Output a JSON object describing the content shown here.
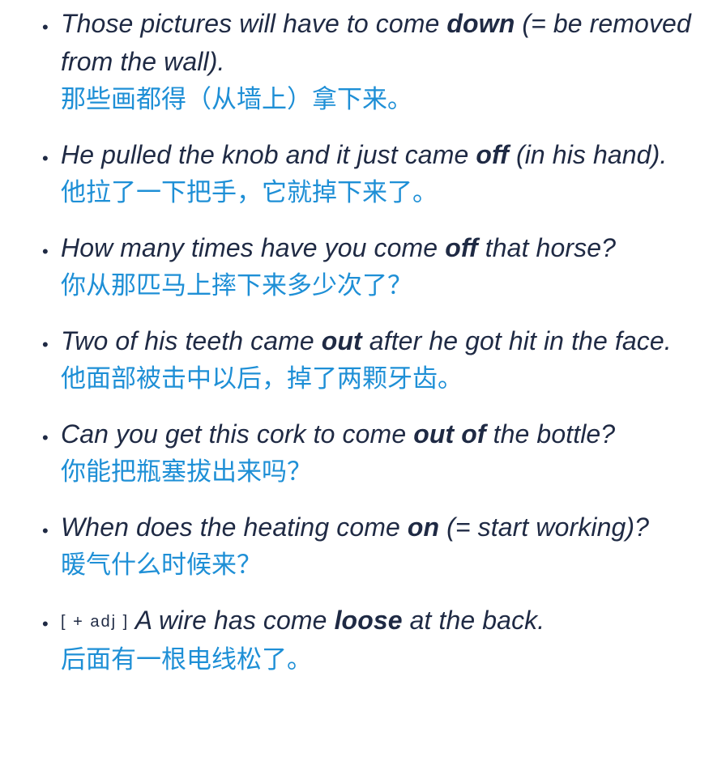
{
  "examples": [
    {
      "pre": "Those pictures will have to come ",
      "keyword": "down",
      "post": " (= be removed from the wall).",
      "translation": "那些画都得（从墙上）拿下来。"
    },
    {
      "pre": "He pulled the knob and it just came ",
      "keyword": "off",
      "post": " (in his hand).",
      "translation": "他拉了一下把手，它就掉下来了。"
    },
    {
      "pre": "How many times have you come ",
      "keyword": "off",
      "post": " that horse?",
      "translation": "你从那匹马上摔下来多少次了？"
    },
    {
      "pre": "Two of his teeth came ",
      "keyword": "out",
      "post": " after he got hit in the face.",
      "translation": "他面部被击中以后，掉了两颗牙齿。"
    },
    {
      "pre": "Can you get this cork to come ",
      "keyword": "out of",
      "post": " the bottle?",
      "translation": "你能把瓶塞拔出来吗？"
    },
    {
      "pre": "When does the heating come ",
      "keyword": "on",
      "post": " (= start working)?",
      "translation": "暖气什么时候来？"
    },
    {
      "grammar": "[ + adj ] ",
      "pre": "A wire has come ",
      "keyword": "loose",
      "post": " at the back.",
      "translation": "后面有一根电线松了。"
    }
  ]
}
